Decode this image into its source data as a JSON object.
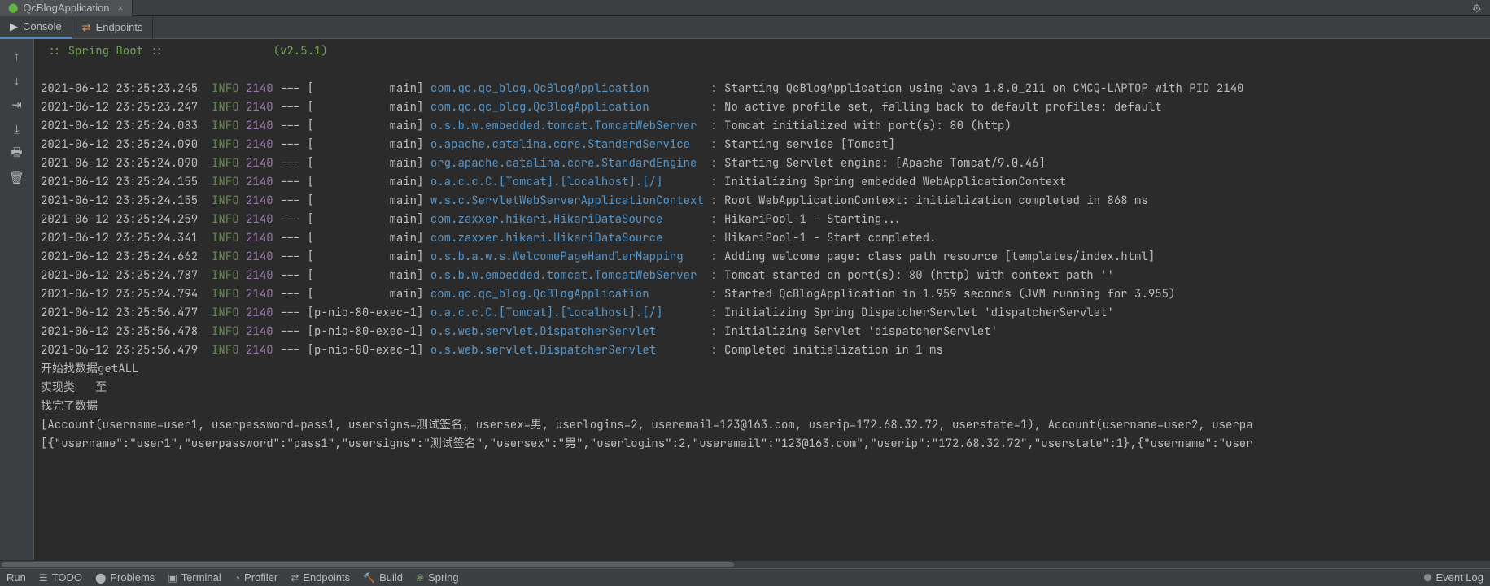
{
  "runConfig": {
    "name": "QcBlogApplication"
  },
  "toolTabs": {
    "console": "Console",
    "endpoints": "Endpoints"
  },
  "banner": {
    "spring": " :: Spring Boot ::",
    "version": "(v2.5.1)"
  },
  "log": [
    {
      "ts": "2021-06-12 23:25:23.245",
      "level": "INFO",
      "pid": "2140",
      "thread": "[           main]",
      "logger": "com.qc.qc_blog.QcBlogApplication",
      "msg": "Starting QcBlogApplication using Java 1.8.0_211 on CMCQ-LAPTOP with PID 2140"
    },
    {
      "ts": "2021-06-12 23:25:23.247",
      "level": "INFO",
      "pid": "2140",
      "thread": "[           main]",
      "logger": "com.qc.qc_blog.QcBlogApplication",
      "msg": "No active profile set, falling back to default profiles: default"
    },
    {
      "ts": "2021-06-12 23:25:24.083",
      "level": "INFO",
      "pid": "2140",
      "thread": "[           main]",
      "logger": "o.s.b.w.embedded.tomcat.TomcatWebServer",
      "msg": "Tomcat initialized with port(s): 80 (http)"
    },
    {
      "ts": "2021-06-12 23:25:24.090",
      "level": "INFO",
      "pid": "2140",
      "thread": "[           main]",
      "logger": "o.apache.catalina.core.StandardService",
      "msg": "Starting service [Tomcat]"
    },
    {
      "ts": "2021-06-12 23:25:24.090",
      "level": "INFO",
      "pid": "2140",
      "thread": "[           main]",
      "logger": "org.apache.catalina.core.StandardEngine",
      "msg": "Starting Servlet engine: [Apache Tomcat/9.0.46]"
    },
    {
      "ts": "2021-06-12 23:25:24.155",
      "level": "INFO",
      "pid": "2140",
      "thread": "[           main]",
      "logger": "o.a.c.c.C.[Tomcat].[localhost].[/]",
      "msg": "Initializing Spring embedded WebApplicationContext"
    },
    {
      "ts": "2021-06-12 23:25:24.155",
      "level": "INFO",
      "pid": "2140",
      "thread": "[           main]",
      "logger": "w.s.c.ServletWebServerApplicationContext",
      "msg": "Root WebApplicationContext: initialization completed in 868 ms"
    },
    {
      "ts": "2021-06-12 23:25:24.259",
      "level": "INFO",
      "pid": "2140",
      "thread": "[           main]",
      "logger": "com.zaxxer.hikari.HikariDataSource",
      "msg": "HikariPool-1 - Starting..."
    },
    {
      "ts": "2021-06-12 23:25:24.341",
      "level": "INFO",
      "pid": "2140",
      "thread": "[           main]",
      "logger": "com.zaxxer.hikari.HikariDataSource",
      "msg": "HikariPool-1 - Start completed."
    },
    {
      "ts": "2021-06-12 23:25:24.662",
      "level": "INFO",
      "pid": "2140",
      "thread": "[           main]",
      "logger": "o.s.b.a.w.s.WelcomePageHandlerMapping",
      "msg": "Adding welcome page: class path resource [templates/index.html]"
    },
    {
      "ts": "2021-06-12 23:25:24.787",
      "level": "INFO",
      "pid": "2140",
      "thread": "[           main]",
      "logger": "o.s.b.w.embedded.tomcat.TomcatWebServer",
      "msg": "Tomcat started on port(s): 80 (http) with context path ''"
    },
    {
      "ts": "2021-06-12 23:25:24.794",
      "level": "INFO",
      "pid": "2140",
      "thread": "[           main]",
      "logger": "com.qc.qc_blog.QcBlogApplication",
      "msg": "Started QcBlogApplication in 1.959 seconds (JVM running for 3.955)"
    },
    {
      "ts": "2021-06-12 23:25:56.477",
      "level": "INFO",
      "pid": "2140",
      "thread": "[p-nio-80-exec-1]",
      "logger": "o.a.c.c.C.[Tomcat].[localhost].[/]",
      "msg": "Initializing Spring DispatcherServlet 'dispatcherServlet'"
    },
    {
      "ts": "2021-06-12 23:25:56.478",
      "level": "INFO",
      "pid": "2140",
      "thread": "[p-nio-80-exec-1]",
      "logger": "o.s.web.servlet.DispatcherServlet",
      "msg": "Initializing Servlet 'dispatcherServlet'"
    },
    {
      "ts": "2021-06-12 23:25:56.479",
      "level": "INFO",
      "pid": "2140",
      "thread": "[p-nio-80-exec-1]",
      "logger": "o.s.web.servlet.DispatcherServlet",
      "msg": "Completed initialization in 1 ms"
    }
  ],
  "plainLines": [
    "开始找数据getALL",
    "实现类   至",
    "找完了数据",
    "[Account(username=user1, userpassword=pass1, usersigns=测试签名, usersex=男, userlogins=2, useremail=123@163.com, userip=172.68.32.72, userstate=1), Account(username=user2, userpa",
    "[{\"username\":\"user1\",\"userpassword\":\"pass1\",\"usersigns\":\"测试签名\",\"usersex\":\"男\",\"userlogins\":2,\"useremail\":\"123@163.com\",\"userip\":\"172.68.32.72\",\"userstate\":1},{\"username\":\"user"
  ],
  "statusBar": {
    "run": "Run",
    "todo": "TODO",
    "problems": "Problems",
    "terminal": "Terminal",
    "profiler": "Profiler",
    "endpoints": "Endpoints",
    "build": "Build",
    "spring": "Spring",
    "eventLog": "Event Log"
  }
}
